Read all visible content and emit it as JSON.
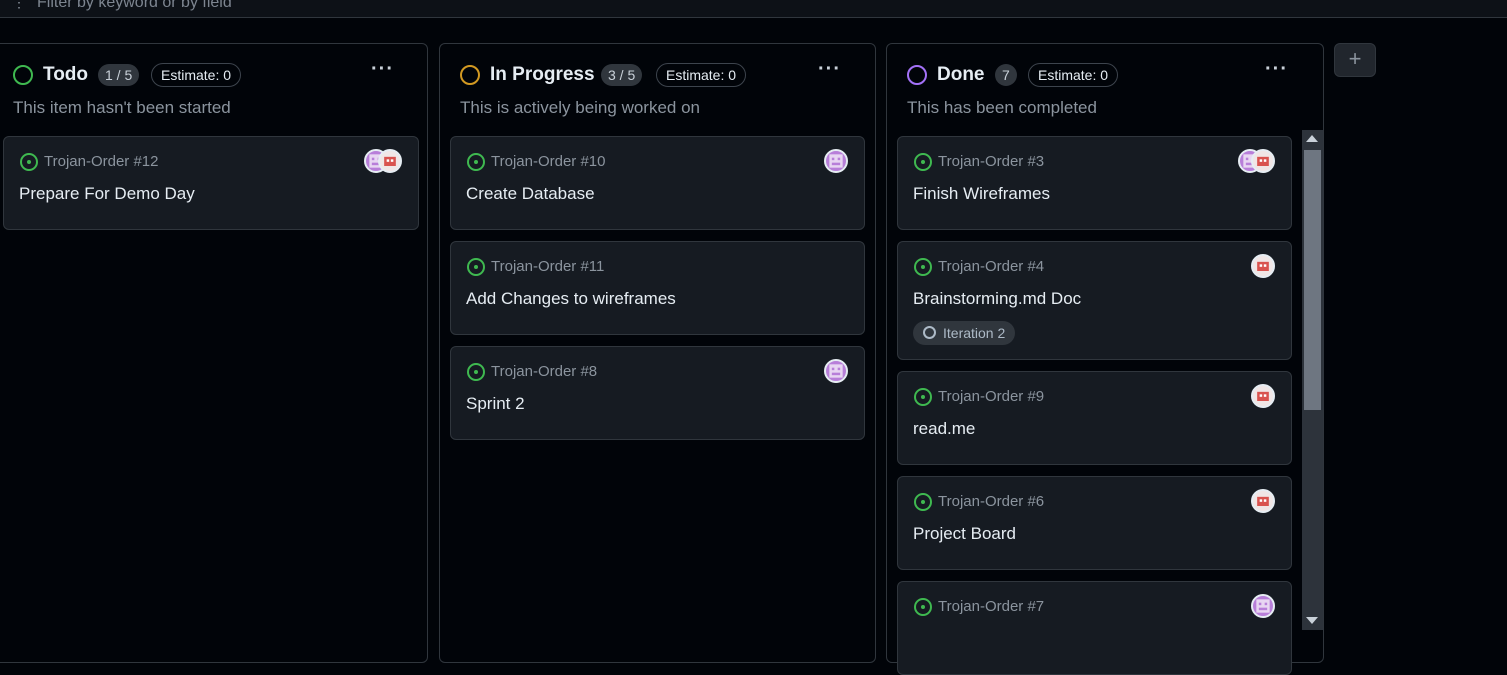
{
  "filter": {
    "placeholder": "Filter by keyword or by field",
    "icon": "filter-icon"
  },
  "columns": [
    {
      "title": "Todo",
      "count": "1 / 5",
      "estimate": "Estimate: 0",
      "description": "This item hasn't been started",
      "status_color": "#3fb950",
      "cards": [
        {
          "ref": "Trojan-Order #12",
          "title": "Prepare For Demo Day",
          "avatars": [
            "purple",
            "red"
          ]
        }
      ]
    },
    {
      "title": "In Progress",
      "count": "3 / 5",
      "estimate": "Estimate: 0",
      "description": "This is actively being worked on",
      "status_color": "#d29922",
      "cards": [
        {
          "ref": "Trojan-Order #10",
          "title": "Create Database",
          "avatars": [
            "purple"
          ]
        },
        {
          "ref": "Trojan-Order #11",
          "title": "Add Changes to wireframes",
          "avatars": []
        },
        {
          "ref": "Trojan-Order #8",
          "title": "Sprint 2",
          "avatars": [
            "purple"
          ]
        }
      ]
    },
    {
      "title": "Done",
      "count": "7",
      "estimate": "Estimate: 0",
      "description": "This has been completed",
      "status_color": "#a371f7",
      "cards": [
        {
          "ref": "Trojan-Order #3",
          "title": "Finish Wireframes",
          "avatars": [
            "purple",
            "red"
          ]
        },
        {
          "ref": "Trojan-Order #4",
          "title": "Brainstorming.md Doc",
          "avatars": [
            "red"
          ],
          "iteration": "Iteration 2"
        },
        {
          "ref": "Trojan-Order #9",
          "title": "read.me",
          "avatars": [
            "red"
          ]
        },
        {
          "ref": "Trojan-Order #6",
          "title": "Project Board",
          "avatars": [
            "red"
          ]
        },
        {
          "ref": "Trojan-Order #7",
          "title": "",
          "avatars": [
            "purple"
          ]
        }
      ]
    }
  ],
  "add_column_label": "+",
  "colors": {
    "issue_open": "#3fb950",
    "background": "#010409",
    "card": "#161b22",
    "border": "#30363d"
  }
}
